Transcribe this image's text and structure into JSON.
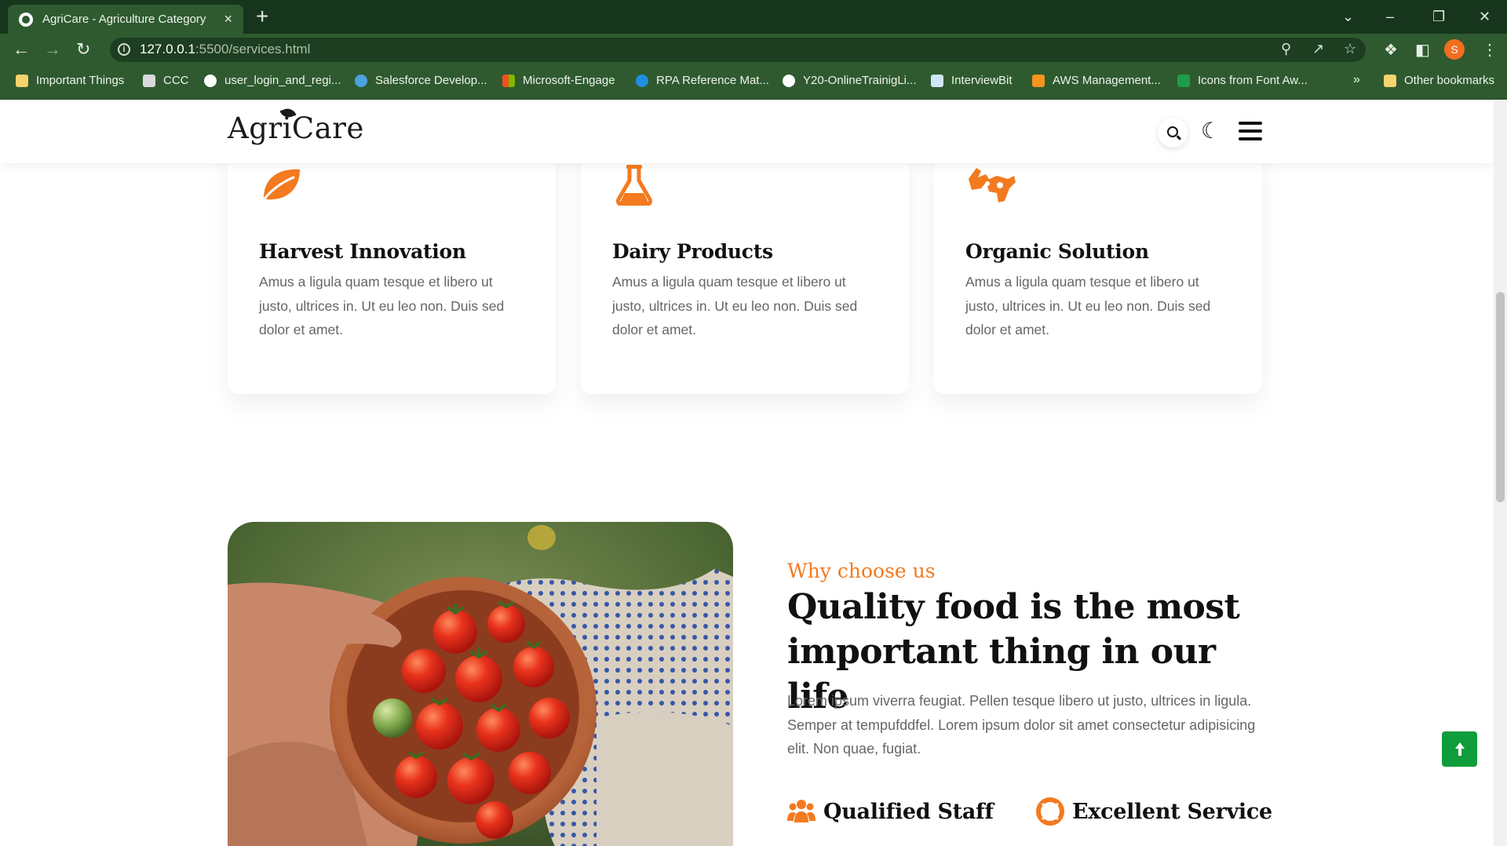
{
  "browser": {
    "tab_title": "AgriCare - Agriculture Category",
    "tab_close": "×",
    "new_tab": "+",
    "url_host": "127.0.0.1",
    "url_path": ":5500/services.html",
    "profile_initial": "S",
    "bookmarks": [
      {
        "label": "Important Things",
        "icon": "folder-icon",
        "color": "#f7d36b"
      },
      {
        "label": "CCC",
        "icon": "page-icon",
        "color": "#d9d9d9"
      },
      {
        "label": "user_login_and_regi...",
        "icon": "github-icon",
        "color": "#ffffff"
      },
      {
        "label": "Salesforce Develop...",
        "icon": "salesforce-icon",
        "color": "#4aa3df"
      },
      {
        "label": "Microsoft-Engage",
        "icon": "microsoft-icon",
        "color": "#f25022"
      },
      {
        "label": "RPA Reference Mat...",
        "icon": "onedrive-icon",
        "color": "#1e8fe1"
      },
      {
        "label": "Y20-OnlineTrainigLi...",
        "icon": "globe-icon",
        "color": "#ffffff"
      },
      {
        "label": "InterviewBit",
        "icon": "interviewbit-icon",
        "color": "#cfe6f7"
      },
      {
        "label": "AWS Management...",
        "icon": "aws-icon",
        "color": "#f7931e"
      },
      {
        "label": "Icons from Font Aw...",
        "icon": "fontawesome-icon",
        "color": "#1e9c4c"
      }
    ],
    "bookmarks_overflow": "»",
    "other_bookmarks": "Other bookmarks"
  },
  "site": {
    "logo": "AgriCare"
  },
  "cards": [
    {
      "title": "Harvest Innovation",
      "text": "Amus a ligula quam tesque et libero ut justo, ultrices in. Ut eu leo non. Duis sed dolor et amet.",
      "icon": "leaf-icon"
    },
    {
      "title": "Dairy Products",
      "text": "Amus a ligula quam tesque et libero ut justo, ultrices in. Ut eu leo non. Duis sed dolor et amet.",
      "icon": "flask-icon"
    },
    {
      "title": "Organic Solution",
      "text": "Amus a ligula quam tesque et libero ut justo, ultrices in. Ut eu leo non. Duis sed dolor et amet.",
      "icon": "hands-icon"
    }
  ],
  "why": {
    "eyebrow": "Why choose us",
    "heading": "Quality food is the most important thing in our life",
    "body": "Lorem ipsum viverra feugiat. Pellen tesque libero ut justo, ultrices in ligula. Semper at tempufddfel. Lorem ipsum dolor sit amet consectetur adipisicing elit. Non quae, fugiat."
  },
  "features": [
    {
      "title": "Qualified Staff",
      "icon": "users-icon"
    },
    {
      "title": "Excellent Service",
      "icon": "lifebuoy-icon"
    }
  ],
  "colors": {
    "accent": "#f37a1f",
    "chrome": "#2f5a30",
    "back_to_top": "#0f9d3c"
  }
}
